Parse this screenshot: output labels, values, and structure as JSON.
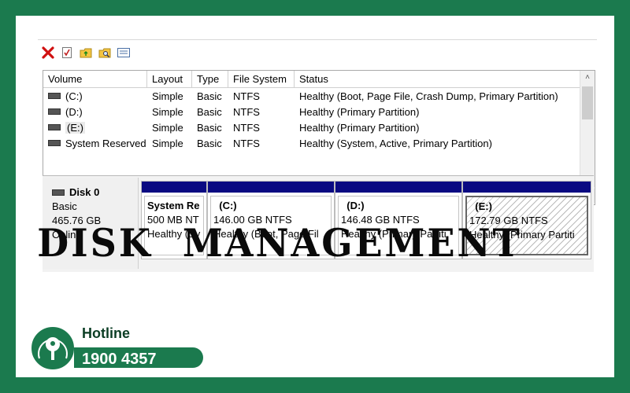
{
  "volume_table": {
    "headers": [
      "Volume",
      "Layout",
      "Type",
      "File System",
      "Status"
    ],
    "rows": [
      {
        "volume": "(C:)",
        "layout": "Simple",
        "type": "Basic",
        "fs": "NTFS",
        "status": "Healthy (Boot, Page File, Crash Dump, Primary Partition)"
      },
      {
        "volume": "(D:)",
        "layout": "Simple",
        "type": "Basic",
        "fs": "NTFS",
        "status": "Healthy (Primary Partition)"
      },
      {
        "volume": "(E:)",
        "layout": "Simple",
        "type": "Basic",
        "fs": "NTFS",
        "status": "Healthy (Primary Partition)"
      },
      {
        "volume": "System Reserved",
        "layout": "Simple",
        "type": "Basic",
        "fs": "NTFS",
        "status": "Healthy (System, Active, Primary Partition)"
      }
    ]
  },
  "disk": {
    "name": "Disk 0",
    "type": "Basic",
    "size": "465.76 GB",
    "state": "Online",
    "partitions": [
      {
        "name": "System Re",
        "size": "500 MB NT",
        "status": "Healthy (Sy"
      },
      {
        "name": "(C:)",
        "size": "146.00 GB NTFS",
        "status": "Healthy (Boot, Page Fil"
      },
      {
        "name": "(D:)",
        "size": "146.48 GB NTFS",
        "status": "Healthy (Primary Partiti"
      },
      {
        "name": "(E:)",
        "size": "172.79 GB NTFS",
        "status": "Healthy (Primary Partiti"
      }
    ]
  },
  "banner": "DISK  MANAGEMENT",
  "hotline": {
    "label": "Hotline",
    "number": "1900 4357"
  },
  "icons": [
    "delete-x-icon",
    "checklist-icon",
    "folder-up-icon",
    "folder-search-icon",
    "properties-icon"
  ],
  "colors": {
    "brand_green": "#1b7a4e",
    "partition_bar": "#0a0a82"
  }
}
